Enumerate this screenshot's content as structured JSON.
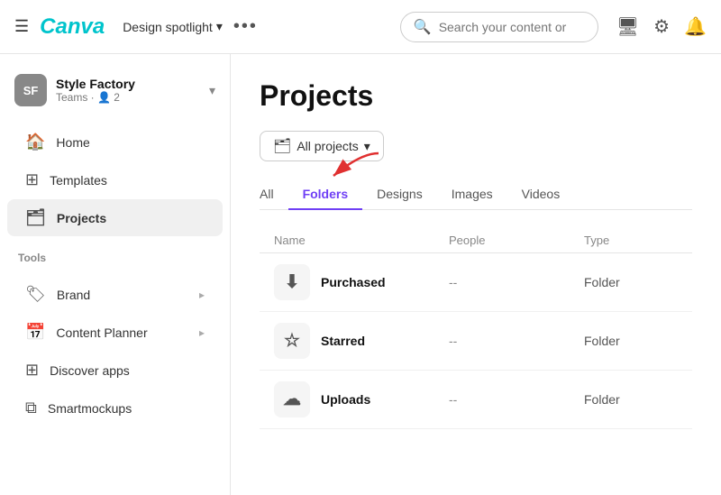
{
  "topnav": {
    "logo": "Canva",
    "design_spotlight_label": "Design spotlight",
    "more_icon": "•••",
    "search_placeholder": "Search your content or",
    "monitor_icon": "🖥",
    "settings_icon": "⚙",
    "bell_icon": "🔔"
  },
  "sidebar": {
    "profile": {
      "initials": "SF",
      "name": "Style Factory",
      "sub": "Teams · 👤 2",
      "avatar_bg": "#777"
    },
    "nav_items": [
      {
        "id": "home",
        "label": "Home",
        "icon": "🏠"
      },
      {
        "id": "templates",
        "label": "Templates",
        "icon": "⊞"
      },
      {
        "id": "projects",
        "label": "Projects",
        "icon": "🗂",
        "active": true
      }
    ],
    "tools_label": "Tools",
    "tools_items": [
      {
        "id": "brand",
        "label": "Brand",
        "icon": "🏷",
        "has_arrow": true
      },
      {
        "id": "content-planner",
        "label": "Content Planner",
        "icon": "📅",
        "has_arrow": true
      },
      {
        "id": "discover-apps",
        "label": "Discover apps",
        "icon": "⊞"
      },
      {
        "id": "smartmockups",
        "label": "Smartmockups",
        "icon": "⧉"
      }
    ]
  },
  "main": {
    "page_title": "Projects",
    "filter": {
      "icon": "🗂",
      "label": "All projects",
      "chevron": "▾"
    },
    "tabs": [
      {
        "id": "all",
        "label": "All",
        "active": false
      },
      {
        "id": "folders",
        "label": "Folders",
        "active": true
      },
      {
        "id": "designs",
        "label": "Designs",
        "active": false
      },
      {
        "id": "images",
        "label": "Images",
        "active": false
      },
      {
        "id": "videos",
        "label": "Videos",
        "active": false
      }
    ],
    "table_headers": {
      "name": "Name",
      "people": "People",
      "type": "Type"
    },
    "table_rows": [
      {
        "icon": "⬇",
        "name": "Purchased",
        "people": "--",
        "type": "Folder"
      },
      {
        "icon": "☆",
        "name": "Starred",
        "people": "--",
        "type": "Folder"
      },
      {
        "icon": "☁",
        "name": "Uploads",
        "people": "--",
        "type": "Folder"
      }
    ]
  }
}
